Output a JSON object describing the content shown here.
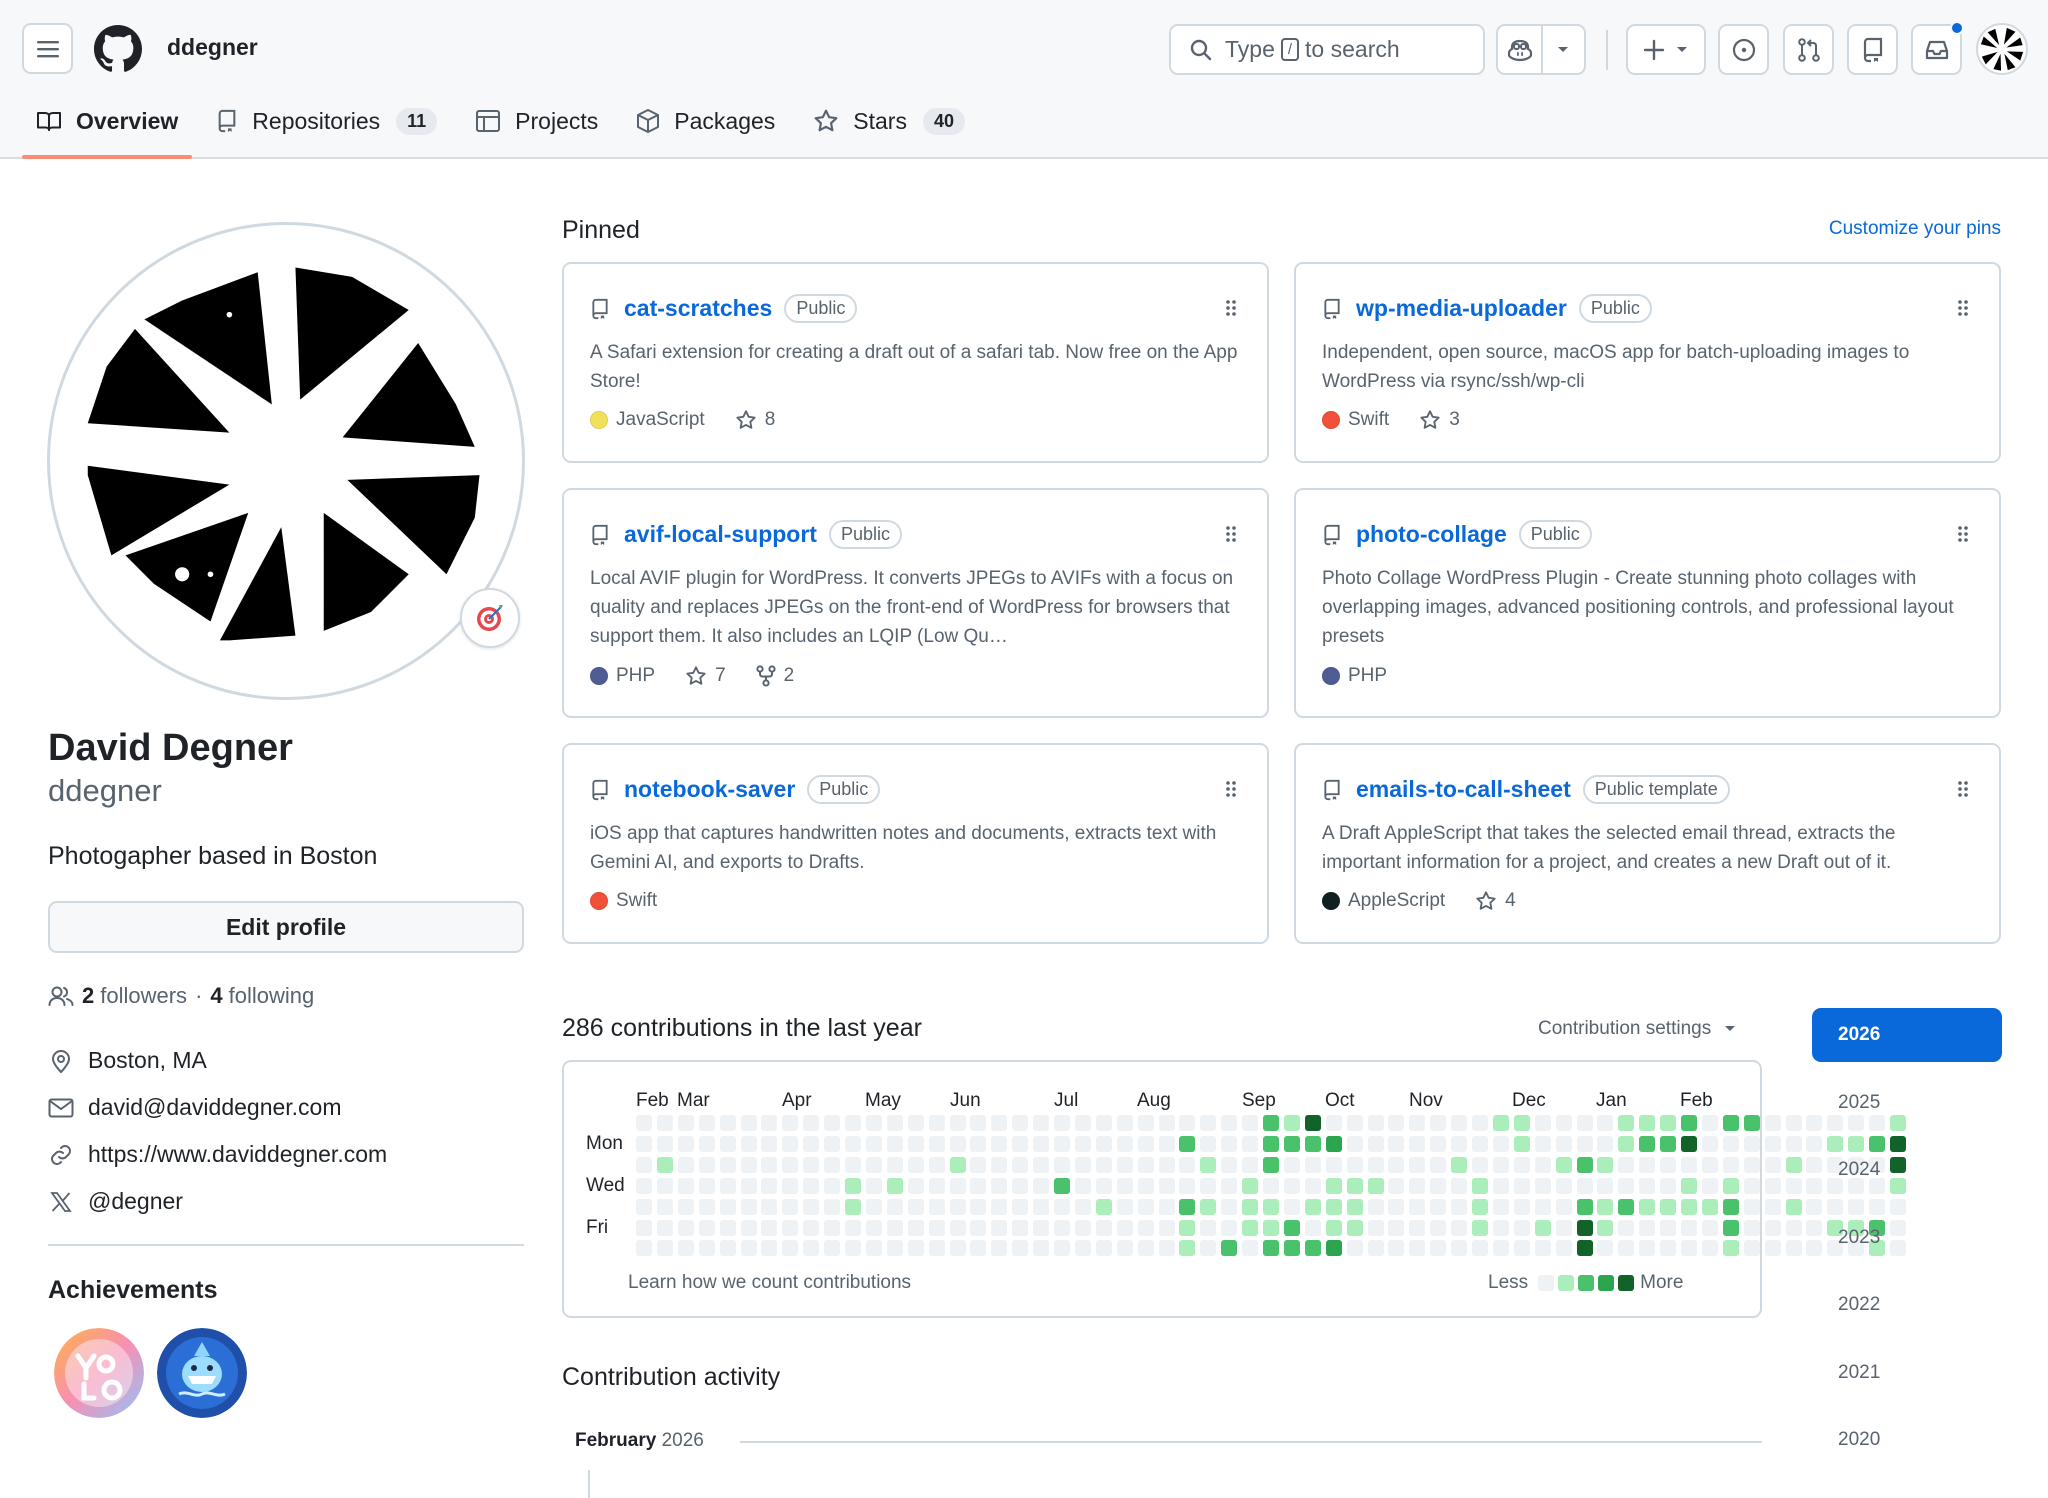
{
  "header": {
    "username": "ddegner",
    "search_prefix": "Type",
    "search_key": "/",
    "search_suffix": "to search"
  },
  "tabs": [
    {
      "label": "Overview",
      "icon": "book-icon",
      "active": true
    },
    {
      "label": "Repositories",
      "icon": "repo-icon",
      "count": "11"
    },
    {
      "label": "Projects",
      "icon": "table-icon"
    },
    {
      "label": "Packages",
      "icon": "package-icon"
    },
    {
      "label": "Stars",
      "icon": "star-icon",
      "count": "40"
    }
  ],
  "profile": {
    "name": "David Degner",
    "login": "ddegner",
    "bio": "Photogapher based in Boston",
    "edit_label": "Edit profile",
    "followers_count": "2",
    "followers_label": "followers",
    "following_count": "4",
    "following_label": "following",
    "location": "Boston, MA",
    "email": "david@daviddegner.com",
    "website": "https://www.daviddegner.com",
    "twitter": "@degner",
    "achievements_title": "Achievements",
    "status_emoji": "dart-target-icon"
  },
  "pinned": {
    "title": "Pinned",
    "customize_label": "Customize your pins",
    "cards": [
      {
        "name": "cat-scratches",
        "visibility": "Public",
        "desc": "A Safari extension for creating a draft out of a safari tab. Now free on the App Store!",
        "lang": "JavaScript",
        "lang_color": "#f1e05a",
        "stars": "8"
      },
      {
        "name": "wp-media-uploader",
        "visibility": "Public",
        "desc": "Independent, open source, macOS app for batch-uploading images to WordPress via rsync/ssh/wp-cli",
        "lang": "Swift",
        "lang_color": "#f05138",
        "stars": "3"
      },
      {
        "name": "avif-local-support",
        "visibility": "Public",
        "desc": "Local AVIF plugin for WordPress. It converts JPEGs to AVIFs with a focus on quality and replaces JPEGs on the front-end of WordPress for browsers that support them. It also includes an LQIP (Low Qu…",
        "lang": "PHP",
        "lang_color": "#4F5D95",
        "stars": "7",
        "forks": "2"
      },
      {
        "name": "photo-collage",
        "visibility": "Public",
        "desc": "Photo Collage WordPress Plugin - Create stunning photo collages with overlapping images, advanced positioning controls, and professional layout presets",
        "lang": "PHP",
        "lang_color": "#4F5D95"
      },
      {
        "name": "notebook-saver",
        "visibility": "Public",
        "desc": "iOS app that captures handwritten notes and documents, extracts text with Gemini AI, and exports to Drafts.",
        "lang": "Swift",
        "lang_color": "#f05138"
      },
      {
        "name": "emails-to-call-sheet",
        "visibility": "Public template",
        "desc": "A Draft AppleScript that takes the selected email thread, extracts the important information for a project, and creates a new Draft out of it.",
        "lang": "AppleScript",
        "lang_color": "#101F1F",
        "stars": "4"
      }
    ]
  },
  "contributions": {
    "title": "286 contributions in the last year",
    "settings_label": "Contribution settings",
    "months": [
      "Feb",
      "Mar",
      "Apr",
      "May",
      "Jun",
      "Jul",
      "Aug",
      "Sep",
      "Oct",
      "Nov",
      "Dec",
      "Jan",
      "Feb"
    ],
    "days": [
      "Mon",
      "Wed",
      "Fri"
    ],
    "learn_label": "Learn how we count contributions",
    "less_label": "Less",
    "more_label": "More",
    "colors": [
      "#eff2f5",
      "#aceebb",
      "#4ac26b",
      "#2da44e",
      "#116329"
    ],
    "weeks": [
      [
        0,
        0,
        0,
        0,
        0,
        0,
        0
      ],
      [
        0,
        0,
        1,
        0,
        0,
        0,
        0
      ],
      [
        0,
        0,
        0,
        0,
        0,
        0,
        0
      ],
      [
        0,
        0,
        0,
        0,
        0,
        0,
        0
      ],
      [
        0,
        0,
        0,
        0,
        0,
        0,
        0
      ],
      [
        0,
        0,
        0,
        0,
        0,
        0,
        0
      ],
      [
        0,
        0,
        0,
        0,
        0,
        0,
        0
      ],
      [
        0,
        0,
        0,
        0,
        0,
        0,
        0
      ],
      [
        0,
        0,
        0,
        0,
        0,
        0,
        0
      ],
      [
        0,
        0,
        0,
        0,
        0,
        0,
        0
      ],
      [
        0,
        0,
        0,
        1,
        1,
        0,
        0
      ],
      [
        0,
        0,
        0,
        0,
        0,
        0,
        0
      ],
      [
        0,
        0,
        0,
        1,
        0,
        0,
        0
      ],
      [
        0,
        0,
        0,
        0,
        0,
        0,
        0
      ],
      [
        0,
        0,
        0,
        0,
        0,
        0,
        0
      ],
      [
        0,
        0,
        1,
        0,
        0,
        0,
        0
      ],
      [
        0,
        0,
        0,
        0,
        0,
        0,
        0
      ],
      [
        0,
        0,
        0,
        0,
        0,
        0,
        0
      ],
      [
        0,
        0,
        0,
        0,
        0,
        0,
        0
      ],
      [
        0,
        0,
        0,
        0,
        0,
        0,
        0
      ],
      [
        0,
        0,
        0,
        2,
        0,
        0,
        0
      ],
      [
        0,
        0,
        0,
        0,
        0,
        0,
        0
      ],
      [
        0,
        0,
        0,
        0,
        1,
        0,
        0
      ],
      [
        0,
        0,
        0,
        0,
        0,
        0,
        0
      ],
      [
        0,
        0,
        0,
        0,
        0,
        0,
        0
      ],
      [
        0,
        0,
        0,
        0,
        0,
        0,
        0
      ],
      [
        0,
        2,
        0,
        0,
        2,
        1,
        1
      ],
      [
        0,
        0,
        1,
        0,
        1,
        0,
        0
      ],
      [
        0,
        0,
        0,
        0,
        0,
        0,
        2
      ],
      [
        0,
        0,
        0,
        1,
        1,
        1,
        0
      ],
      [
        2,
        2,
        2,
        0,
        1,
        1,
        2
      ],
      [
        1,
        2,
        0,
        0,
        0,
        2,
        2
      ],
      [
        4,
        2,
        0,
        0,
        1,
        0,
        2
      ],
      [
        0,
        3,
        0,
        1,
        1,
        1,
        3
      ],
      [
        0,
        0,
        0,
        1,
        1,
        1,
        0
      ],
      [
        0,
        0,
        0,
        1,
        0,
        0,
        0
      ],
      [
        0,
        0,
        0,
        0,
        0,
        0,
        0
      ],
      [
        0,
        0,
        0,
        0,
        0,
        0,
        0
      ],
      [
        0,
        0,
        0,
        0,
        0,
        0,
        0
      ],
      [
        0,
        0,
        1,
        0,
        0,
        0,
        0
      ],
      [
        0,
        0,
        0,
        1,
        1,
        1,
        0
      ],
      [
        1,
        0,
        0,
        0,
        0,
        0,
        0
      ],
      [
        1,
        1,
        0,
        0,
        0,
        0,
        0
      ],
      [
        0,
        0,
        0,
        0,
        0,
        1,
        0
      ],
      [
        0,
        0,
        1,
        0,
        0,
        0,
        0
      ],
      [
        0,
        0,
        2,
        0,
        2,
        4,
        4
      ],
      [
        0,
        0,
        1,
        0,
        1,
        1,
        0
      ],
      [
        1,
        1,
        0,
        0,
        2,
        0,
        0
      ],
      [
        1,
        2,
        0,
        0,
        1,
        0,
        0
      ],
      [
        1,
        2,
        0,
        0,
        1,
        0,
        0
      ],
      [
        2,
        4,
        0,
        1,
        1,
        0,
        0
      ],
      [
        0,
        0,
        0,
        0,
        1,
        0,
        0
      ],
      [
        2,
        0,
        0,
        1,
        2,
        2,
        1
      ],
      [
        2,
        0,
        0,
        0,
        0,
        0,
        0
      ],
      [
        0,
        0,
        0,
        0,
        0,
        0,
        0
      ],
      [
        0,
        0,
        1,
        0,
        1,
        0,
        0
      ],
      [
        0,
        0,
        0,
        0,
        0,
        0,
        0
      ],
      [
        0,
        1,
        0,
        0,
        0,
        1,
        0
      ],
      [
        0,
        1,
        0,
        0,
        0,
        1,
        0
      ],
      [
        0,
        2,
        0,
        0,
        0,
        2,
        1
      ],
      [
        1,
        4,
        4,
        1,
        0,
        0,
        0
      ]
    ]
  },
  "years": [
    "2026",
    "2025",
    "2024",
    "2023",
    "2022",
    "2021",
    "2020"
  ],
  "activity": {
    "title": "Contribution activity",
    "month": "February",
    "year": "2026"
  }
}
